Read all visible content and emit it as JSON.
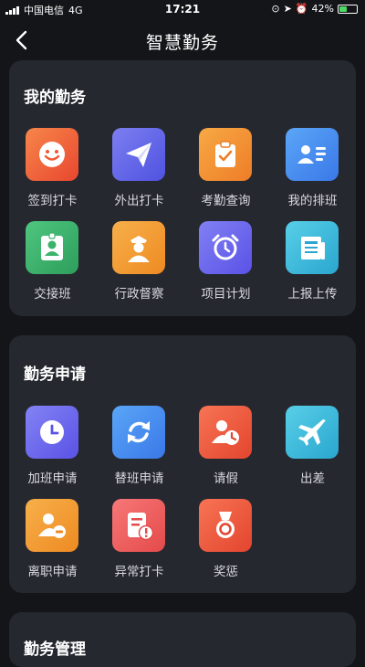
{
  "status_bar": {
    "carrier": "中国电信",
    "network": "4G",
    "time": "17:21",
    "battery": "42%"
  },
  "nav": {
    "title": "智慧勤务"
  },
  "sections": [
    {
      "title": "我的勤务",
      "items": [
        {
          "label": "签到打卡",
          "icon": "smile-face-icon",
          "color": "#ef5a3a"
        },
        {
          "label": "外出打卡",
          "icon": "paper-plane-icon",
          "color": "#5b63e6"
        },
        {
          "label": "考勤查询",
          "icon": "clipboard-check-icon",
          "color": "#f2902f"
        },
        {
          "label": "我的排班",
          "icon": "contact-card-icon",
          "color": "#3f8df0"
        },
        {
          "label": "交接班",
          "icon": "person-badge-icon",
          "color": "#3bb36b"
        },
        {
          "label": "行政督察",
          "icon": "officer-icon",
          "color": "#f29a2b"
        },
        {
          "label": "项目计划",
          "icon": "alarm-clock-icon",
          "color": "#6a62ee"
        },
        {
          "label": "上报上传",
          "icon": "newspaper-icon",
          "color": "#33b8d8"
        }
      ]
    },
    {
      "title": "勤务申请",
      "items": [
        {
          "label": "加班申请",
          "icon": "clock-icon",
          "color": "#6b62ee"
        },
        {
          "label": "替班申请",
          "icon": "refresh-icon",
          "color": "#3f8df0"
        },
        {
          "label": "请假",
          "icon": "person-clock-icon",
          "color": "#ee5a3c"
        },
        {
          "label": "出差",
          "icon": "airplane-icon",
          "color": "#33b8d8"
        },
        {
          "label": "离职申请",
          "icon": "person-minus-icon",
          "color": "#f29a2b"
        },
        {
          "label": "异常打卡",
          "icon": "document-warning-icon",
          "color": "#ef5a4a"
        },
        {
          "label": "奖惩",
          "icon": "medal-icon",
          "color": "#ee5a3c"
        }
      ]
    },
    {
      "title": "勤务管理"
    }
  ]
}
